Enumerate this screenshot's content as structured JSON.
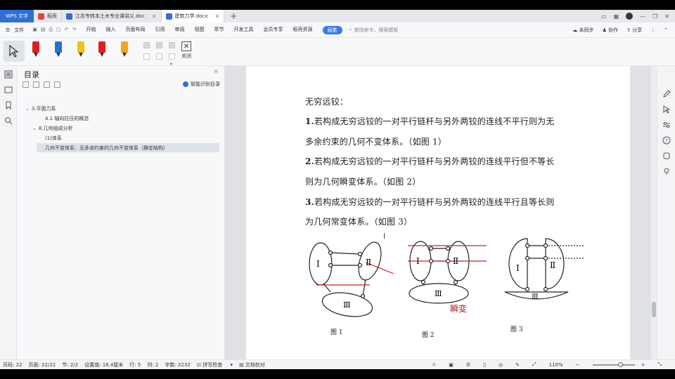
{
  "tabs": {
    "app_label": "WPS 文字",
    "items": [
      {
        "label": "稻壳",
        "color": "#e8433a"
      },
      {
        "label": "江苏专转本土木专业课讲义.doc",
        "color": "#2f6fd6"
      },
      {
        "label": "建筑力学.docx",
        "color": "#2f6fd6"
      }
    ],
    "add": "+"
  },
  "menubar": {
    "file": "文件",
    "items": [
      "开始",
      "插入",
      "页面布局",
      "引用",
      "审阅",
      "视图",
      "章节",
      "开发工具",
      "会员专享",
      "稻壳资源",
      "画笔"
    ],
    "active_index": 10,
    "search_placeholder": "查找命令、搜索模板",
    "right": [
      "未同步",
      "协作",
      "分享"
    ]
  },
  "inkbar": {
    "close_label": "关闭",
    "pens": [
      "#e02020",
      "#2a6fd6",
      "#f2c21b",
      "#e02020",
      "#f3a41b"
    ]
  },
  "toc": {
    "title": "目录",
    "smart_label": "智能识别目录",
    "items": [
      "3.平面力系",
      "4.1 轴向拉压的概念",
      "8.几何组成分析",
      "(1)体系",
      "几何不变体系：无多余约束的几何不变体系（静定结构）"
    ]
  },
  "document": {
    "heading": "无穷远铰：",
    "p1_num": "1.",
    "p1_a": "若构成无穷远铰的一对平行链杆与另外两铰的连线不平行则为无",
    "p1_b": "多余约束的几何不变体系。（如图 1）",
    "p2_num": "2.",
    "p2_a": "若构成无穷远铰的一对平行链杆与另外两铰的连线平行但不等长",
    "p2_b": "则为几何瞬变体系。（如图 2）",
    "p3_num": "3.",
    "p3_a": "若构成无穷远铰的一对平行链杆与另外两铰的连线平行且等长则",
    "p3_b": "为几何常变体系。（如图 3）",
    "fig1": "图 1",
    "fig2": "图 2",
    "fig3": "图 3",
    "roman1": "Ⅰ",
    "roman2": "Ⅱ",
    "roman3": "Ⅲ",
    "handwriting": "瞬变"
  },
  "status": {
    "page_num": "页码: 22",
    "pages": "页面: 22/22",
    "section": "节: 2/2",
    "setting": "设置值: 18.4厘米",
    "row": "行: 5",
    "col": "列: 2",
    "words": "字数: 2232",
    "spell": "拼写检查",
    "proof": "文档校对",
    "zoom": "110%"
  }
}
